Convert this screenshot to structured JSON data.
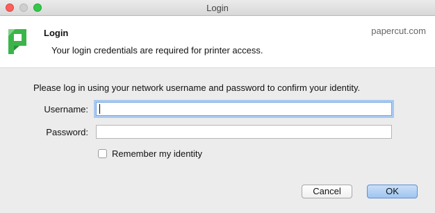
{
  "window": {
    "title": "Login"
  },
  "banner": {
    "title": "Login",
    "subtitle": "Your login credentials are required for printer access.",
    "brand_url": "papercut.com"
  },
  "form": {
    "instructions": "Please log in using your network username and password to confirm your identity.",
    "username_label": "Username:",
    "username_value": "",
    "password_label": "Password:",
    "password_value": "",
    "remember_label": "Remember my identity",
    "remember_checked": false
  },
  "buttons": {
    "cancel": "Cancel",
    "ok": "OK"
  },
  "colors": {
    "logo_green": "#3bb54a",
    "default_button": "#9ec5f1",
    "focus_ring": "#a9c9f2"
  },
  "icons": {
    "app_logo": "papercut-logo-icon"
  }
}
